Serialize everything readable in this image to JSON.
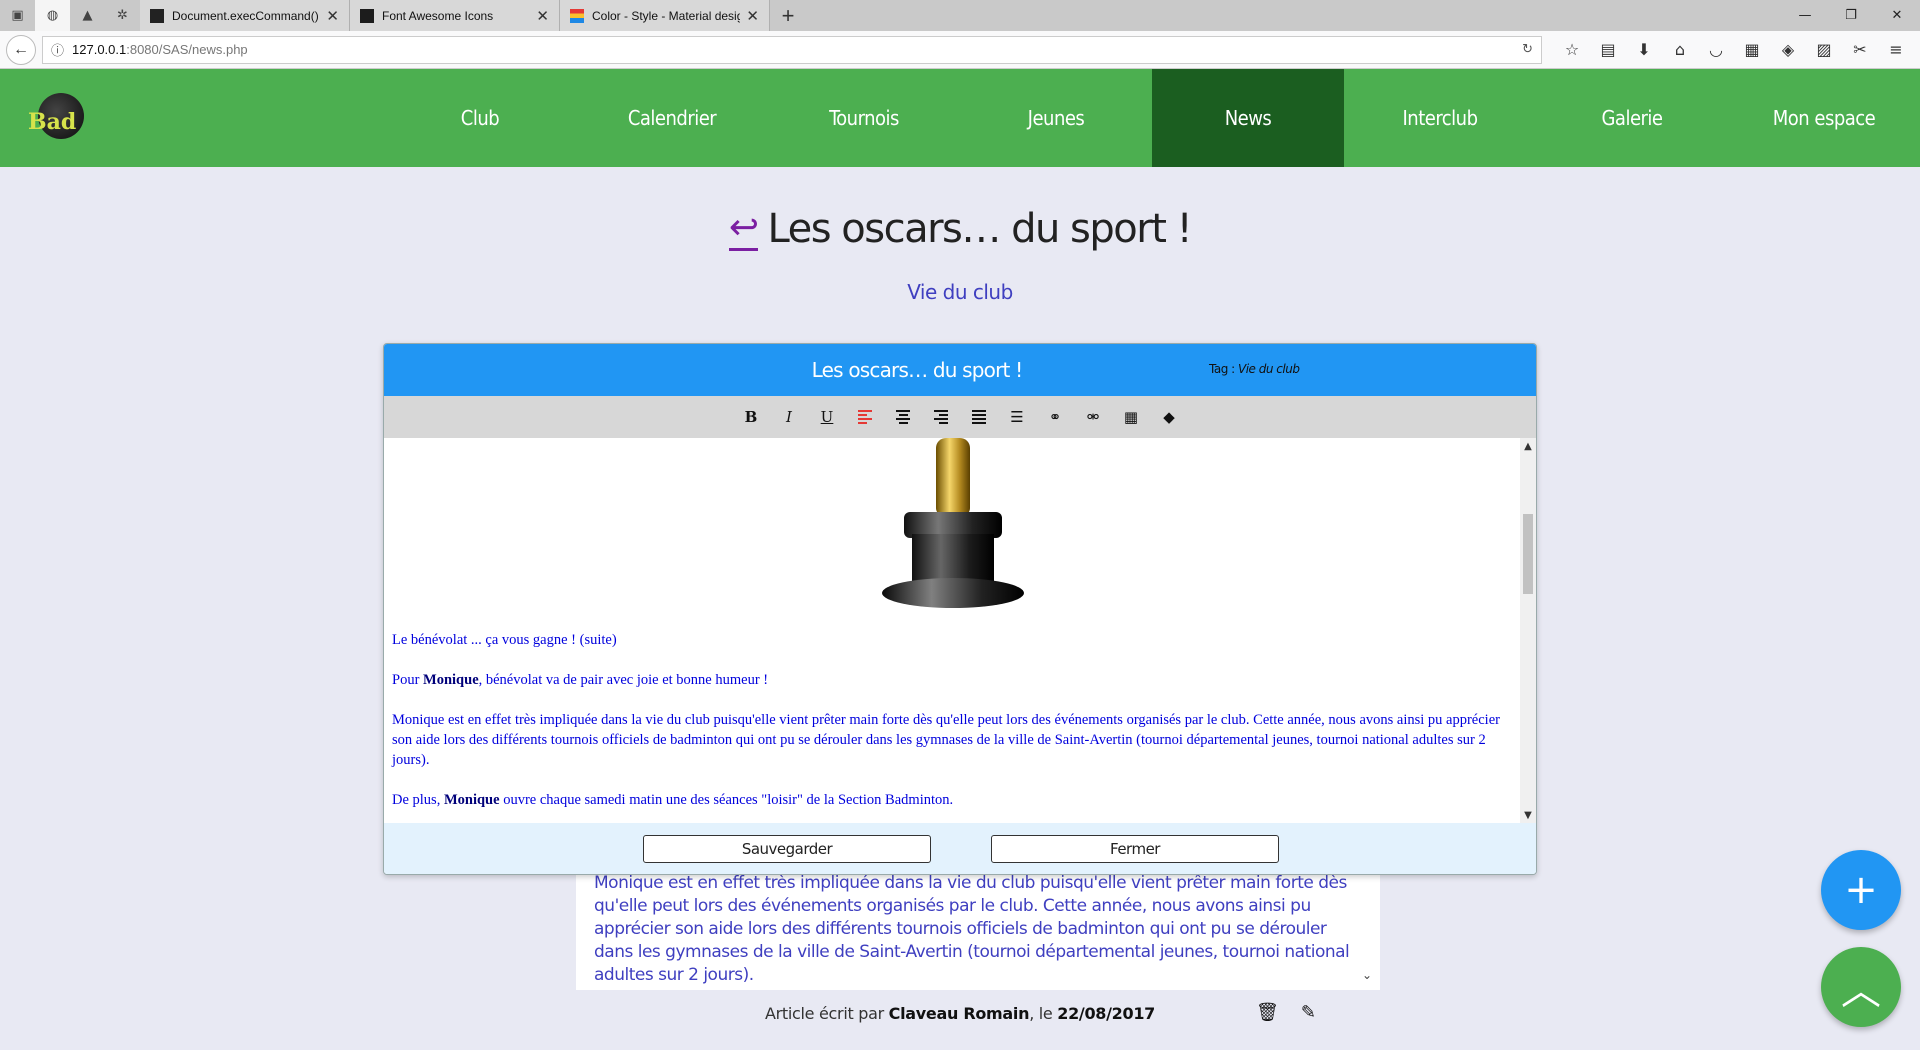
{
  "browser": {
    "pinned_tabs": [
      "pinned-tab-1",
      "pinned-tab-2",
      "pinned-tab-3",
      "pinned-tab-4"
    ],
    "tabs": [
      {
        "label": "Document.execCommand()",
        "icon": "mdn-icon"
      },
      {
        "label": "Font Awesome Icons",
        "icon": "fontawesome-icon"
      },
      {
        "label": "Color - Style - Material design",
        "icon": "material-icon"
      }
    ],
    "new_tab": "+",
    "url_host": "127.0.0.1",
    "url_path": ":8080/SAS/news.php"
  },
  "site": {
    "logo_text": "Bad",
    "menu": [
      {
        "label": "Club",
        "active": false
      },
      {
        "label": "Calendrier",
        "active": false
      },
      {
        "label": "Tournois",
        "active": false
      },
      {
        "label": "Jeunes",
        "active": false
      },
      {
        "label": "News",
        "active": true
      },
      {
        "label": "Interclub",
        "active": false
      },
      {
        "label": "Galerie",
        "active": false
      },
      {
        "label": "Mon espace",
        "active": false
      }
    ],
    "colors": {
      "header": "#4caf50",
      "active_menu": "#1b5e20",
      "modal_header": "#2196f3"
    }
  },
  "page": {
    "back_icon": "↩",
    "title": "Les oscars… du sport !",
    "tag": "Vie du club"
  },
  "modal": {
    "title": "Les oscars… du sport !",
    "tag_label": "Tag : ",
    "tag_value": "Vie du club",
    "toolbar": [
      "bold",
      "italic",
      "underline",
      "align-left",
      "align-center",
      "align-right",
      "justify",
      "list",
      "link",
      "unlink",
      "table",
      "tag"
    ],
    "content": {
      "p1": "Le bénévolat ... ça vous gagne ! (suite)",
      "p2_pre": "Pour ",
      "p2_bold": "Monique",
      "p2_post": ", bénévolat va de pair avec joie et bonne humeur !",
      "p3": "Monique est en effet très impliquée dans la vie du club puisqu'elle vient prêter main forte dès qu'elle peut lors des événements organisés par le club. Cette année, nous avons ainsi pu apprécier son aide lors des différents tournois officiels de badminton qui ont pu se dérouler dans les gymnases de la ville de Saint-Avertin (tournoi départemental jeunes, tournoi national adultes sur 2 jours).",
      "p4_pre": "De plus, ",
      "p4_bold": "Monique",
      "p4_post": " ouvre chaque samedi matin une des séances \"loisir\" de la Section Badminton."
    },
    "save_label": "Sauvegarder",
    "close_label": "Fermer"
  },
  "article": {
    "text": "Monique est en effet très impliquée dans la vie du club puisqu'elle vient prêter main forte dès qu'elle peut lors des événements organisés par le club. Cette année, nous avons ainsi pu apprécier son aide lors des différents tournois officiels de badminton qui ont pu se dérouler dans les gymnases de la ville de Saint-Avertin (tournoi départemental jeunes, tournoi national adultes sur 2 jours).",
    "byline_pre": "Article écrit par ",
    "author": "Claveau Romain",
    "byline_mid": ", le ",
    "date": "22/08/2017"
  }
}
